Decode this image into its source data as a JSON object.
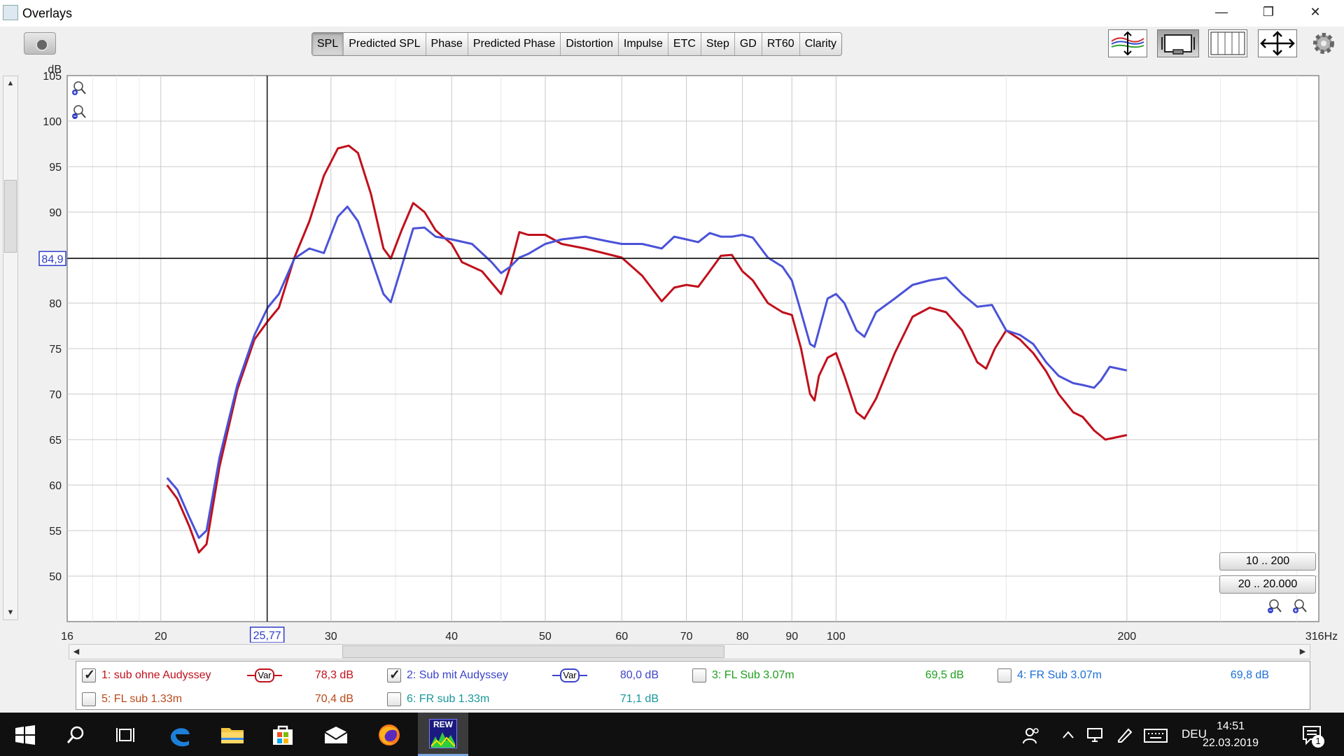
{
  "window": {
    "title": "Overlays",
    "controls": {
      "minimize": "—",
      "maximize": "❐",
      "close": "✕"
    }
  },
  "toolbar": {
    "tabs": [
      {
        "label": "SPL",
        "active": true
      },
      {
        "label": "Predicted SPL",
        "active": false
      },
      {
        "label": "Phase",
        "active": false
      },
      {
        "label": "Predicted Phase",
        "active": false
      },
      {
        "label": "Distortion",
        "active": false
      },
      {
        "label": "Impulse",
        "active": false
      },
      {
        "label": "ETC",
        "active": false
      },
      {
        "label": "Step",
        "active": false
      },
      {
        "label": "GD",
        "active": false
      },
      {
        "label": "RT60",
        "active": false
      },
      {
        "label": "Clarity",
        "active": false
      }
    ],
    "right_icons": [
      "traces-icon",
      "graph-view-icon",
      "columns-icon",
      "move-arrows-icon",
      "gear-icon"
    ]
  },
  "graph": {
    "y_unit": "dB",
    "cursor_y_label": "84,9",
    "cursor_x_label": "25,77",
    "range_buttons": [
      "10 .. 200",
      "20 .. 20.000"
    ]
  },
  "chart_data": {
    "type": "line",
    "xscale": "log",
    "xlim": [
      16,
      316
    ],
    "ylim": [
      45,
      105
    ],
    "x_tick_labels": [
      "16",
      "20",
      "30",
      "40",
      "50",
      "60",
      "70",
      "80",
      "90",
      "100",
      "200",
      "316Hz"
    ],
    "y_tick_labels": [
      "105",
      "100",
      "95",
      "90",
      "85",
      "80",
      "75",
      "70",
      "65",
      "60",
      "55",
      "50"
    ],
    "grid": true,
    "cursor": {
      "x": 25.77,
      "y": 84.9
    },
    "series": [
      {
        "name": "1: sub ohne Audyssey",
        "color": "#c0101c",
        "points": [
          [
            20.3,
            60
          ],
          [
            20.8,
            58.5
          ],
          [
            21.4,
            55.5
          ],
          [
            21.9,
            52.6
          ],
          [
            22.3,
            53.5
          ],
          [
            23,
            62
          ],
          [
            24,
            70.5
          ],
          [
            25,
            76
          ],
          [
            25.8,
            78
          ],
          [
            26.5,
            79.5
          ],
          [
            27.5,
            85
          ],
          [
            28.5,
            89
          ],
          [
            29.5,
            94
          ],
          [
            30.5,
            97
          ],
          [
            31.3,
            97.3
          ],
          [
            32,
            96.5
          ],
          [
            33,
            92
          ],
          [
            34,
            86
          ],
          [
            34.6,
            84.9
          ],
          [
            35.5,
            88
          ],
          [
            36.5,
            91
          ],
          [
            37.5,
            90
          ],
          [
            38.5,
            88
          ],
          [
            40,
            86.5
          ],
          [
            41,
            84.5
          ],
          [
            43,
            83.5
          ],
          [
            45,
            81
          ],
          [
            46,
            84
          ],
          [
            47,
            87.8
          ],
          [
            48,
            87.5
          ],
          [
            50,
            87.5
          ],
          [
            52,
            86.5
          ],
          [
            55,
            86
          ],
          [
            60,
            85
          ],
          [
            63,
            83
          ],
          [
            66,
            80.2
          ],
          [
            68,
            81.7
          ],
          [
            70,
            82
          ],
          [
            72,
            81.8
          ],
          [
            74,
            83.5
          ],
          [
            76,
            85.2
          ],
          [
            78,
            85.3
          ],
          [
            80,
            83.5
          ],
          [
            82,
            82.5
          ],
          [
            85,
            80
          ],
          [
            88,
            79
          ],
          [
            90,
            78.7
          ],
          [
            92,
            75
          ],
          [
            94,
            70
          ],
          [
            95,
            69.3
          ],
          [
            96,
            72
          ],
          [
            98,
            74
          ],
          [
            100,
            74.5
          ],
          [
            102,
            72
          ],
          [
            105,
            68
          ],
          [
            107,
            67.3
          ],
          [
            110,
            69.5
          ],
          [
            115,
            74.5
          ],
          [
            120,
            78.5
          ],
          [
            125,
            79.5
          ],
          [
            130,
            79
          ],
          [
            135,
            77
          ],
          [
            140,
            73.5
          ],
          [
            143,
            72.8
          ],
          [
            146,
            75
          ],
          [
            150,
            77
          ],
          [
            155,
            76
          ],
          [
            160,
            74.5
          ],
          [
            165,
            72.5
          ],
          [
            170,
            70
          ],
          [
            176,
            68
          ],
          [
            180,
            67.5
          ],
          [
            185,
            66
          ],
          [
            190,
            65
          ],
          [
            194,
            65.2
          ],
          [
            200,
            65.5
          ]
        ]
      },
      {
        "name": "2: Sub mit Audyssey",
        "color": "#4a52d8",
        "points": [
          [
            20.3,
            60.8
          ],
          [
            20.8,
            59.5
          ],
          [
            21.4,
            56.5
          ],
          [
            21.9,
            54.2
          ],
          [
            22.3,
            55
          ],
          [
            23,
            63
          ],
          [
            24,
            71
          ],
          [
            25,
            76.5
          ],
          [
            25.8,
            79.5
          ],
          [
            26.5,
            81
          ],
          [
            27.5,
            84.9
          ],
          [
            28.5,
            86
          ],
          [
            29.5,
            85.5
          ],
          [
            30.5,
            89.5
          ],
          [
            31.2,
            90.6
          ],
          [
            32,
            89
          ],
          [
            33,
            85
          ],
          [
            34,
            81
          ],
          [
            34.6,
            80.1
          ],
          [
            35.5,
            84
          ],
          [
            36.5,
            88.2
          ],
          [
            37.5,
            88.3
          ],
          [
            38.5,
            87.3
          ],
          [
            40,
            87
          ],
          [
            42,
            86.5
          ],
          [
            44,
            84.5
          ],
          [
            45,
            83.3
          ],
          [
            46,
            84
          ],
          [
            47,
            85
          ],
          [
            48,
            85.4
          ],
          [
            50,
            86.5
          ],
          [
            52,
            87
          ],
          [
            55,
            87.3
          ],
          [
            58,
            86.8
          ],
          [
            60,
            86.5
          ],
          [
            63,
            86.5
          ],
          [
            66,
            86
          ],
          [
            68,
            87.3
          ],
          [
            70,
            87
          ],
          [
            72,
            86.7
          ],
          [
            74,
            87.7
          ],
          [
            76,
            87.3
          ],
          [
            78,
            87.3
          ],
          [
            80,
            87.5
          ],
          [
            82,
            87.2
          ],
          [
            85,
            85
          ],
          [
            88,
            84
          ],
          [
            90,
            82.5
          ],
          [
            92,
            79
          ],
          [
            94,
            75.5
          ],
          [
            95,
            75.2
          ],
          [
            96,
            77
          ],
          [
            98,
            80.5
          ],
          [
            100,
            81
          ],
          [
            102,
            80
          ],
          [
            105,
            77
          ],
          [
            107,
            76.3
          ],
          [
            110,
            79
          ],
          [
            115,
            80.5
          ],
          [
            120,
            82
          ],
          [
            125,
            82.5
          ],
          [
            130,
            82.8
          ],
          [
            135,
            81
          ],
          [
            140,
            79.6
          ],
          [
            145,
            79.8
          ],
          [
            150,
            77
          ],
          [
            155,
            76.5
          ],
          [
            160,
            75.5
          ],
          [
            165,
            73.5
          ],
          [
            170,
            72
          ],
          [
            176,
            71.2
          ],
          [
            180,
            71
          ],
          [
            185,
            70.7
          ],
          [
            188,
            71.5
          ],
          [
            192,
            73
          ],
          [
            196,
            72.8
          ],
          [
            200,
            72.6
          ]
        ]
      }
    ]
  },
  "legend": {
    "items": [
      {
        "id": 1,
        "checked": true,
        "name": "1: sub ohne Audyssey",
        "value": "78,3 dB",
        "color": "#c0101c",
        "var_label": "Var",
        "show_var": true
      },
      {
        "id": 2,
        "checked": true,
        "name": "2: Sub mit Audyssey",
        "value": "80,0 dB",
        "color": "#3c44c8",
        "var_label": "Var",
        "show_var": true
      },
      {
        "id": 3,
        "checked": false,
        "name": "3: FL Sub 3.07m",
        "value": "69,5 dB",
        "color": "#1e9e1e",
        "show_var": false
      },
      {
        "id": 4,
        "checked": false,
        "name": "4: FR Sub 3.07m",
        "value": "69,8 dB",
        "color": "#1c6fd6",
        "show_var": false
      },
      {
        "id": 5,
        "checked": false,
        "name": "5: FL sub 1.33m",
        "value": "70,4 dB",
        "color": "#b8491a",
        "show_var": false
      },
      {
        "id": 6,
        "checked": false,
        "name": "6: FR sub 1.33m",
        "value": "71,1 dB",
        "color": "#18979a",
        "show_var": false
      }
    ]
  },
  "taskbar": {
    "apps": [
      "windows-start",
      "search",
      "task-view",
      "edge",
      "file-explorer",
      "store",
      "mail",
      "firefox",
      "rew"
    ],
    "rew_badge": "REW",
    "language": "DEU",
    "time": "14:51",
    "date": "22.03.2019",
    "notification_count": "1"
  }
}
